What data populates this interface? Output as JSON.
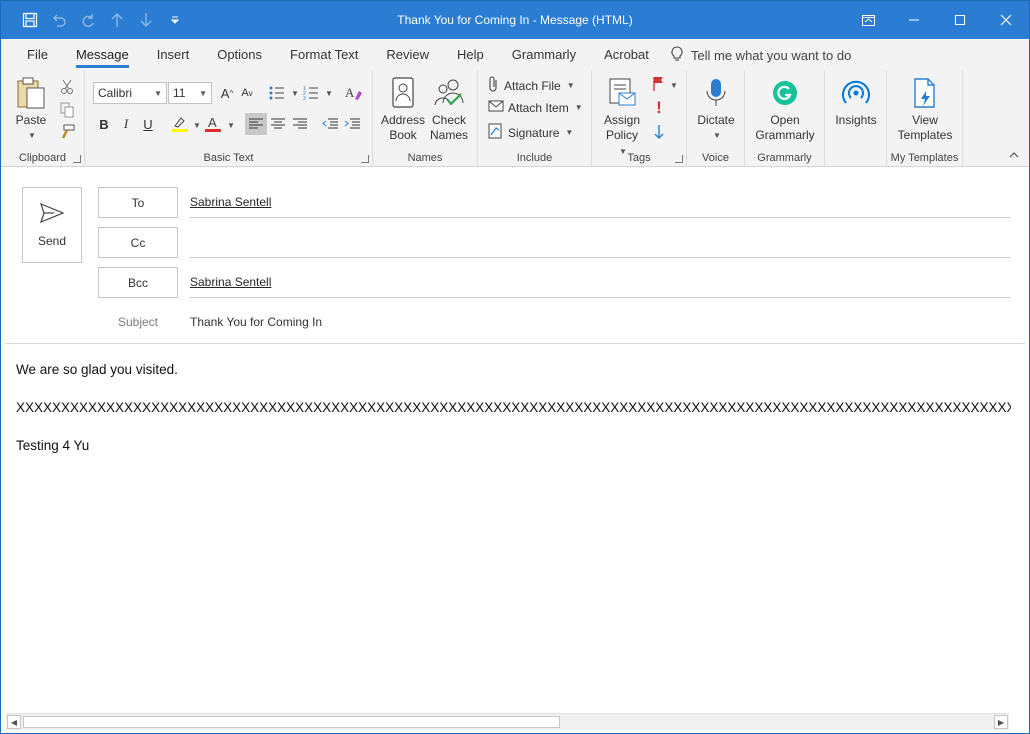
{
  "window": {
    "title": "Thank You for Coming In",
    "title_separator": " - ",
    "title_suffix": "Message (HTML)"
  },
  "quick_access": [
    "save-icon",
    "undo-icon",
    "redo-icon",
    "previous-item-icon",
    "next-item-icon",
    "customize-icon"
  ],
  "tabs": [
    {
      "label": "File",
      "active": false
    },
    {
      "label": "Message",
      "active": true
    },
    {
      "label": "Insert",
      "active": false
    },
    {
      "label": "Options",
      "active": false
    },
    {
      "label": "Format Text",
      "active": false
    },
    {
      "label": "Review",
      "active": false
    },
    {
      "label": "Help",
      "active": false
    },
    {
      "label": "Grammarly",
      "active": false
    },
    {
      "label": "Acrobat",
      "active": false
    }
  ],
  "tell_me": "Tell me what you want to do",
  "ribbon": {
    "clipboard": {
      "label": "Clipboard",
      "paste": "Paste"
    },
    "basic_text": {
      "label": "Basic Text",
      "font": "Calibri",
      "size": "11",
      "bold": "B",
      "italic": "I",
      "underline": "U"
    },
    "names": {
      "label": "Names",
      "address_book_1": "Address",
      "address_book_2": "Book",
      "check_names_1": "Check",
      "check_names_2": "Names"
    },
    "include": {
      "label": "Include",
      "attach_file": "Attach File",
      "attach_item": "Attach Item",
      "signature": "Signature"
    },
    "tags": {
      "label": "Tags",
      "assign_1": "Assign",
      "assign_2": "Policy"
    },
    "voice": {
      "label": "Voice",
      "dictate": "Dictate"
    },
    "grammarly": {
      "label": "Grammarly",
      "open_1": "Open",
      "open_2": "Grammarly"
    },
    "insights": {
      "label": "Insights"
    },
    "templates": {
      "label": "My Templates",
      "view_1": "View",
      "view_2": "Templates"
    }
  },
  "compose": {
    "send": "Send",
    "to_label": "To",
    "to_value": "Sabrina Sentell",
    "cc_label": "Cc",
    "cc_value": "",
    "bcc_label": "Bcc",
    "bcc_value": "Sabrina Sentell",
    "subject_label": "Subject",
    "subject_value": "Thank You for Coming In"
  },
  "body": {
    "line1": "We are so glad you visited.",
    "line2": "XXXXXXXXXXXXXXXXXXXXXXXXXXXXXXXXXXXXXXXXXXXXXXXXXXXXXXXXXXXXXXXXXXXXXXXXXXXXXXXXXXXXXXXXXXXXXXXXXXXXXXXXXXXXXXXXXXXXXXXXXX",
    "line3": "Testing 4 Yu"
  },
  "colors": {
    "accent": "#2b7cd3",
    "flag": "#d13438",
    "grammarly": "#15c39a",
    "insights": "#0078d4"
  }
}
